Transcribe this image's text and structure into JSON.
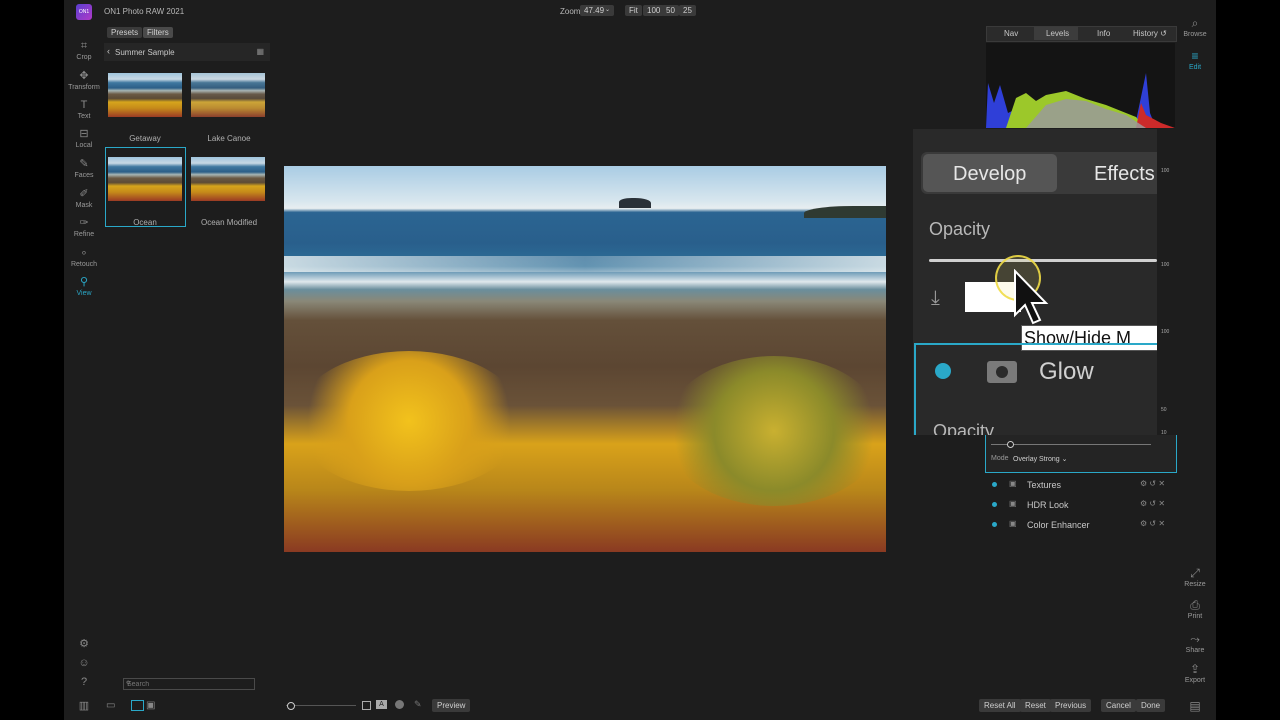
{
  "app": {
    "title": "ON1 Photo RAW 2021",
    "logo_text": "ON1"
  },
  "zoom": {
    "label": "Zoom",
    "value": "47.49",
    "fit": "Fit",
    "z100": "100",
    "z50": "50",
    "z25": "25"
  },
  "tools": [
    {
      "label": "Crop",
      "icon": "crop-icon"
    },
    {
      "label": "Transform",
      "icon": "move-icon"
    },
    {
      "label": "Text",
      "icon": "text-icon"
    },
    {
      "label": "Local",
      "icon": "local-icon"
    },
    {
      "label": "Faces",
      "icon": "faces-icon"
    },
    {
      "label": "Mask",
      "icon": "mask-icon"
    },
    {
      "label": "Refine",
      "icon": "refine-icon"
    },
    {
      "label": "Retouch",
      "icon": "retouch-icon"
    },
    {
      "label": "View",
      "icon": "view-icon"
    }
  ],
  "presets_panel": {
    "tab_presets": "Presets",
    "tab_filters": "Filters",
    "folder": "Summer Sample",
    "thumbs": [
      "Getaway",
      "Lake Canoe",
      "Ocean",
      "Ocean Modified"
    ],
    "search_placeholder": "Search"
  },
  "right_tabs": {
    "nav": "Nav",
    "levels": "Levels",
    "info": "Info",
    "history": "History"
  },
  "right_rail": {
    "browse": "Browse",
    "edit": "Edit",
    "resize": "Resize",
    "print": "Print",
    "share": "Share",
    "export": "Export"
  },
  "zoom_overlay": {
    "tab_develop": "Develop",
    "tab_effects": "Effects",
    "opacity_label": "Opacity",
    "tooltip": "Show/Hide M",
    "filter_name": "Glow",
    "opacity_label_2": "Opacity"
  },
  "panel_small": {
    "n100a": "100",
    "n100b": "100",
    "n100c": "100",
    "n50": "50",
    "n10": "10",
    "mode_label": "Mode",
    "mode_value": "Overlay Strong"
  },
  "filters": [
    "Textures",
    "HDR Look",
    "Color Enhancer"
  ],
  "bottom": {
    "preview": "Preview",
    "reset_all": "Reset All",
    "reset": "Reset",
    "previous": "Previous",
    "cancel": "Cancel",
    "done": "Done"
  },
  "colors": {
    "accent": "#2aa8c8",
    "panel": "#1d1d1d",
    "button": "#3a3a3a"
  }
}
